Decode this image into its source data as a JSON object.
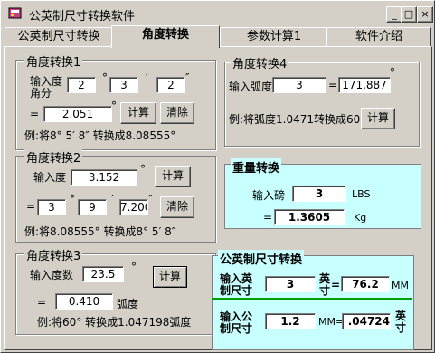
{
  "window": {
    "title": "公英制尺寸转换软件",
    "minimize": "_",
    "maximize": "□",
    "close": "×"
  },
  "tabs": [
    "公英制尺寸转换",
    "角度转换",
    "参数计算1",
    "软件介绍"
  ],
  "angle1": {
    "title": "角度转换1",
    "label_line1": "输入度",
    "label_line2": "角分",
    "deg": "2",
    "deg_sym": "°",
    "min": "3",
    "min_sym": "′",
    "sec": "2",
    "sec_sym": "″",
    "eq": "=",
    "result": "2.051",
    "result_sym": "°",
    "calc": "计算",
    "clear": "清除",
    "example": "例:将8° 5′ 8″ 转换成8.08555°"
  },
  "angle2": {
    "title": "角度转换2",
    "label": "输入度",
    "value": "3.152",
    "value_sym": "°",
    "calc": "计算",
    "eq": "=",
    "deg": "3",
    "deg_sym": "°",
    "min": "9",
    "min_sym": "′",
    "sec": "7.200",
    "sec_sym": "″",
    "clear": "清除",
    "example": "例:将8.08555° 转换成8° 5′ 8″"
  },
  "angle3": {
    "title": "角度转换3",
    "label": "输入度数",
    "value": "23.5",
    "value_sym": "°",
    "calc": "计算",
    "eq": "=",
    "result": "0.410",
    "unit": "弧度",
    "example": "例:将60° 转换成1.047198弧度"
  },
  "angle4": {
    "title": "角度转换4",
    "label": "输入弧度",
    "value": "3",
    "eq": "=",
    "result": "171.887",
    "result_sym": "°",
    "example": "例:将弧度1.0471转换成60°",
    "calc": "计算"
  },
  "weight": {
    "title": "重量转换",
    "label": "输入磅",
    "value": "3",
    "unit_in": "LBS",
    "eq": "=",
    "result": "1.3605",
    "unit_out": "Kg"
  },
  "size": {
    "title": "公英制尺寸转换",
    "in_label_1": "输入英",
    "in_label_2": "制尺寸",
    "in_value": "3",
    "in_unit_1": "英",
    "in_unit_2": "寸",
    "in_eq": "=",
    "in_result": "76.2",
    "in_result_unit": "MM",
    "mm_label_1": "输入公",
    "mm_label_2": "制尺寸",
    "mm_value": "1.2",
    "mm_unit": "MM=",
    "mm_result": ".04724",
    "mm_result_unit_1": "英",
    "mm_result_unit_2": "寸"
  },
  "colors": {
    "cyan_panel": "#c8ffff",
    "face": "#d4d0c8"
  }
}
